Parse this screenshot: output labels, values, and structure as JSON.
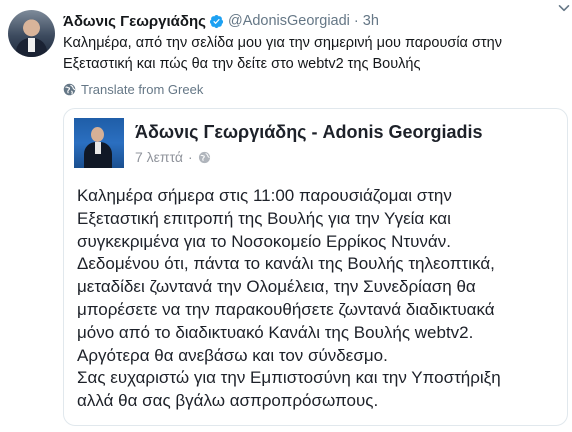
{
  "tweet": {
    "display_name": "Άδωνις Γεωργιάδης",
    "handle": "@AdonisGeorgiadi",
    "separator": "·",
    "time": "3h",
    "text": "Καλημέρα, από την σελίδα μου για την σημερινή μου παρουσία στην Εξεταστική και πώς θα την δείτε στο webtv2 της Βουλής",
    "translate_label": "Translate from Greek"
  },
  "card": {
    "title": "Άδωνις Γεωργιάδης - Adonis Georgiadis",
    "time": "7 λεπτά",
    "dot": "·",
    "lines": [
      "Καλημέρα σήμερα στις 11:00 παρουσιάζομαι στην",
      "Εξεταστική επιτροπή της Βουλής για την Υγεία και",
      "συγκεκριμένα για το Νοσοκομείο Ερρίκος Ντυνάν.",
      "Δεδομένου ότι, πάντα το κανάλι της Βουλής τηλεοπτικά,",
      "μεταδίδει ζωντανά την Ολομέλεια, την Συνεδρίαση θα",
      "μπορέσετε να την παρακουθήσετε ζωντανά διαδικτυακά",
      "μόνο από το διαδικτυακό Κανάλι της Βουλής webtv2.",
      "Αργότερα θα ανεβάσω και τον σύνδεσμο.",
      "Σας ευχαριστώ για την Εμπιστοσύνη και την Υποστήριξη",
      "αλλά θα σας βγάλω ασπροπρόσωπους."
    ]
  },
  "colors": {
    "verified": "#1da1f2",
    "secondary": "#657786"
  },
  "icons": [
    "verified-badge-icon",
    "chevron-down-icon",
    "globe-icon",
    "public-globe-icon"
  ]
}
